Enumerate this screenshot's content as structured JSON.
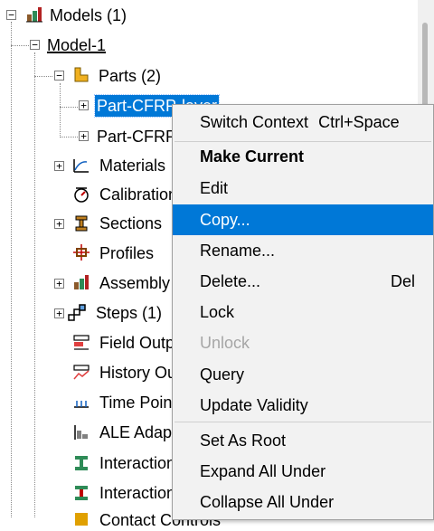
{
  "tree": {
    "models_label": "Models (1)",
    "model_label": "Model-1",
    "parts_label": "Parts (2)",
    "part1_label": "Part-CFRP-layer",
    "part2_label": "Part-CFRP-layer",
    "items": {
      "materials": "Materials",
      "calibrations": "Calibrations",
      "sections": "Sections",
      "profiles": "Profiles",
      "assembly": "Assembly",
      "steps": "Steps (1)",
      "field_output": "Field Output Requests",
      "history_output": "History Output Requests",
      "time_points": "Time Points",
      "ale": "ALE Adaptive Mesh Constraints",
      "interactions": "Interactions",
      "interaction_props": "Interaction Properties",
      "contact": "Contact Controls"
    }
  },
  "context_menu": {
    "switch_context": "Switch Context",
    "switch_context_accel": "Ctrl+Space",
    "make_current": "Make Current",
    "edit": "Edit",
    "copy": "Copy...",
    "rename": "Rename...",
    "delete": "Delete...",
    "delete_accel": "Del",
    "lock": "Lock",
    "unlock": "Unlock",
    "query": "Query",
    "update_validity": "Update Validity",
    "set_as_root": "Set As Root",
    "expand_all_under": "Expand All Under",
    "collapse_all_under": "Collapse All Under"
  },
  "colors": {
    "selection": "#0078d7",
    "menu_bg": "#f2f2f2",
    "disabled_text": "#a6a6a6"
  }
}
